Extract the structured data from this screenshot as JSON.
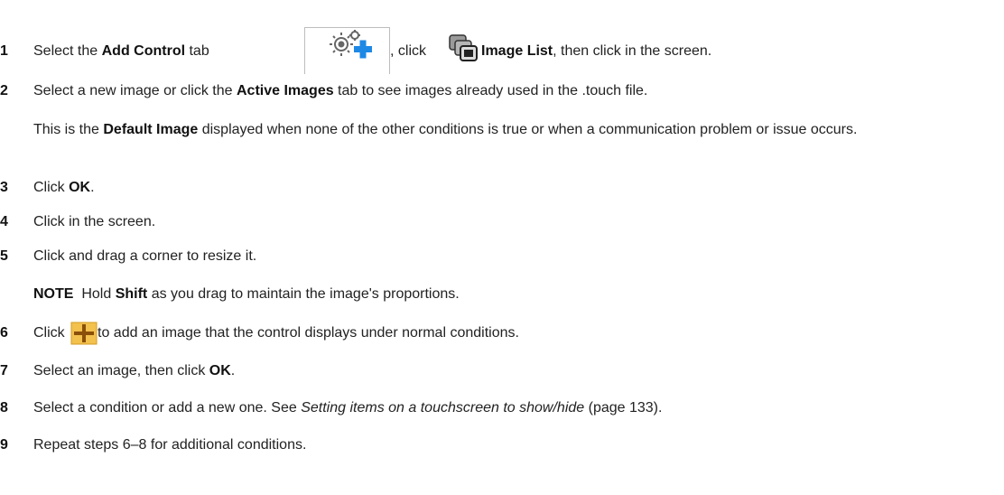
{
  "steps": [
    {
      "num": "1",
      "parts": {
        "a": "Select the ",
        "b": "Add Control",
        "c": " tab",
        "d": ", click",
        "e": "Image List",
        "f": ", then click in the screen."
      },
      "icons": [
        "gear-plus-icon",
        "image-list-icon"
      ]
    },
    {
      "num": "2",
      "parts": {
        "a": "Select a new image or click the ",
        "b": "Active Images",
        "c": " tab to see images already used in the .touch file."
      },
      "note": {
        "a": "This is the ",
        "b": "Default Image",
        "c": " displayed when none of the other conditions is true or when a communication problem or issue occurs."
      }
    },
    {
      "num": "3",
      "parts": {
        "a": "Click ",
        "b": "OK",
        "c": "."
      }
    },
    {
      "num": "4",
      "parts": {
        "a": "Click in the screen."
      }
    },
    {
      "num": "5",
      "parts": {
        "a": "Click and drag a corner to resize it."
      },
      "note": {
        "a": "NOTE",
        "b": "  Hold ",
        "c": "Shift",
        "d": " as you drag to maintain the image's proportions."
      }
    },
    {
      "num": "6",
      "parts": {
        "a": "Click ",
        "b": " to add an image that the control displays under normal conditions."
      },
      "icons": [
        "plus-icon"
      ]
    },
    {
      "num": "7",
      "parts": {
        "a": "Select an image, then click ",
        "b": "OK",
        "c": "."
      }
    },
    {
      "num": "8",
      "parts": {
        "a": "Select a condition or add a new one. See ",
        "b": "Setting items on a touchscreen to show/hide",
        "c": " (page 133)."
      }
    },
    {
      "num": "9",
      "parts": {
        "a": "Repeat steps 6–8 for additional conditions."
      }
    }
  ],
  "colors": {
    "plus_fill": "#f2c14e",
    "plus_cross": "#8a4f0a",
    "gear_plus_blue": "#1e88e5"
  }
}
